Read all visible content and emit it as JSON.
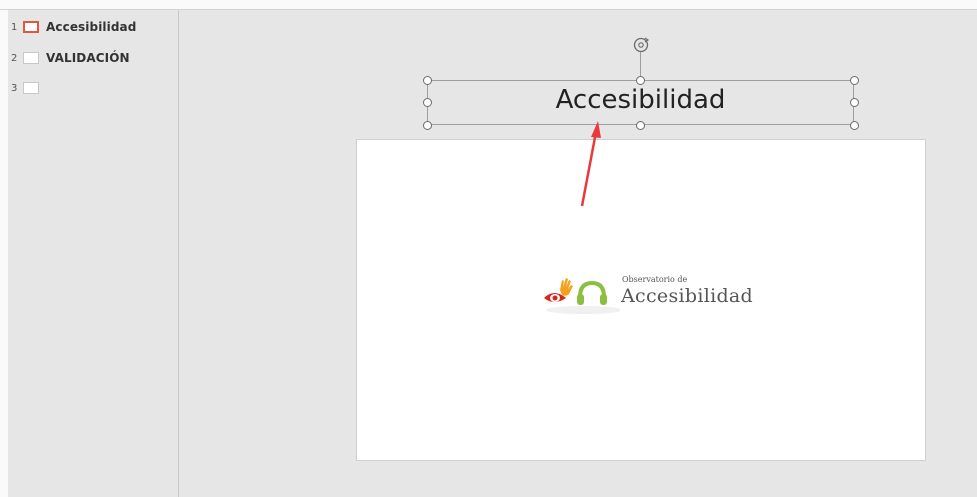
{
  "slides": [
    {
      "number": "1",
      "title": "Accesibilidad",
      "active": true
    },
    {
      "number": "2",
      "title": "VALIDACIÓN",
      "active": false
    },
    {
      "number": "3",
      "title": "",
      "active": false
    }
  ],
  "canvas": {
    "title_text": "Accesibilidad",
    "logo": {
      "small_text": "Observatorio de",
      "big_text": "Accesibilidad"
    }
  },
  "colors": {
    "accent": "#e2563b",
    "arrow": "#e83a3a",
    "background": "#e6e6e6"
  },
  "icons": {
    "rotate": "rotate-handle-icon"
  }
}
